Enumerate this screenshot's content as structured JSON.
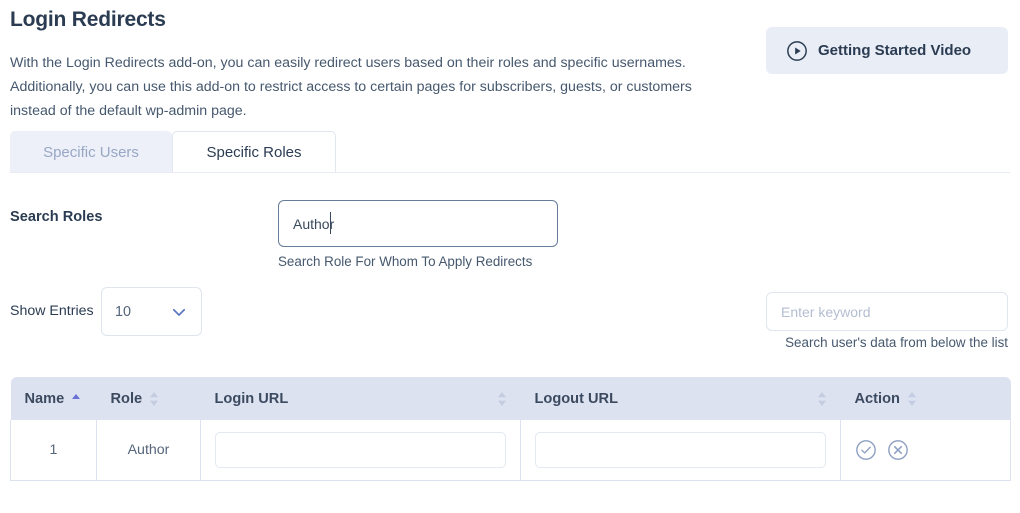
{
  "header": {
    "title": "Login Redirects",
    "description": "With the Login Redirects add-on, you can easily redirect users based on their roles and specific usernames. Additionally, you can use this add-on to restrict access to certain pages for subscribers, guests, or customers instead of the default wp-admin page.",
    "video_button_label": "Getting Started Video",
    "video_button_icon": "play-circle-icon"
  },
  "tabs": [
    {
      "label": "Specific Users",
      "active": false
    },
    {
      "label": "Specific Roles",
      "active": true
    }
  ],
  "search_roles": {
    "label": "Search Roles",
    "value": "Author",
    "placeholder": "",
    "hint": "Search Role For Whom To Apply Redirects"
  },
  "show_entries": {
    "label": "Show Entries",
    "value": "10",
    "icon": "chevron-down-icon"
  },
  "keyword_search": {
    "value": "",
    "placeholder": "Enter keyword",
    "hint": "Search user's data from below the list"
  },
  "table": {
    "columns": [
      {
        "label": "Name",
        "sort": "asc",
        "align": "left"
      },
      {
        "label": "Role",
        "sort": "none",
        "align": "left"
      },
      {
        "label": "Login URL",
        "sort": "none",
        "align": "center"
      },
      {
        "label": "Logout URL",
        "sort": "none",
        "align": "center"
      },
      {
        "label": "Action",
        "sort": "none",
        "align": "left"
      }
    ],
    "rows": [
      {
        "name": "1",
        "role": "Author",
        "login_url": "",
        "logout_url": "",
        "login_url_placeholder": "",
        "logout_url_placeholder": "",
        "actions": [
          "check-circle-icon",
          "close-circle-icon"
        ]
      }
    ]
  },
  "colors": {
    "title": "#2b3c52",
    "body_text": "#46586e",
    "accent_header_bg": "#dce2f0",
    "tab_inactive_bg": "#edf0f8",
    "sort_active": "#6b72d6",
    "sort_inactive": "#c3cce0",
    "action_icon": "#8c9ec1"
  }
}
